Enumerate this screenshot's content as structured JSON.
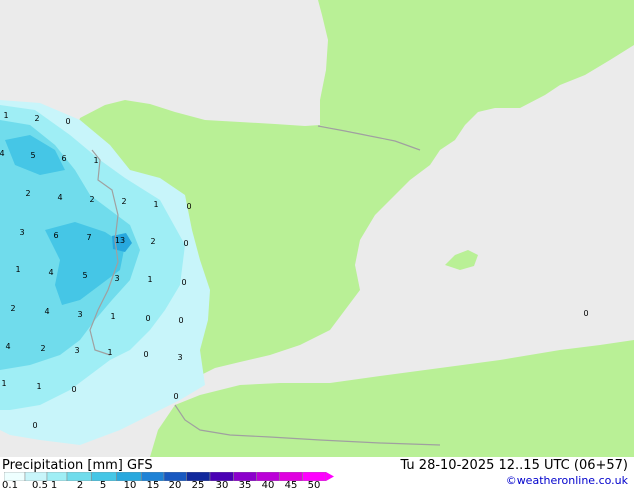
{
  "footer": {
    "title": "Precipitation [mm] GFS",
    "datetime": "Tu 28-10-2025 12..15 UTC (06+57)",
    "credit": "©weatheronline.co.uk"
  },
  "legend": {
    "labels": [
      "0.1",
      "0.5",
      "1",
      "2",
      "5",
      "10",
      "15",
      "20",
      "25",
      "30",
      "35",
      "40",
      "45",
      "50"
    ],
    "colors": [
      "#eeffff",
      "#c8f5fa",
      "#9feef5",
      "#70dcec",
      "#45c6e6",
      "#28a8de",
      "#1e82d6",
      "#1858c0",
      "#10289c",
      "#4a00b4",
      "#8c00cc",
      "#bb00d8",
      "#e000e0",
      "#ff00ff"
    ]
  },
  "map": {
    "colors": {
      "land": "#b9f096",
      "sea": "#ebebeb",
      "border": "#a0a0a0"
    },
    "values": [
      "1",
      "2",
      "0",
      "4",
      "5",
      "6",
      "1",
      "2",
      "4",
      "2",
      "2",
      "1",
      "0",
      "3",
      "6",
      "7",
      "13",
      "2",
      "0",
      "1",
      "4",
      "5",
      "3",
      "1",
      "0",
      "2",
      "4",
      "3",
      "1",
      "0",
      "0",
      "4",
      "2",
      "3",
      "1",
      "0",
      "3",
      "1",
      "1",
      "0",
      "0",
      "0",
      "0"
    ]
  }
}
